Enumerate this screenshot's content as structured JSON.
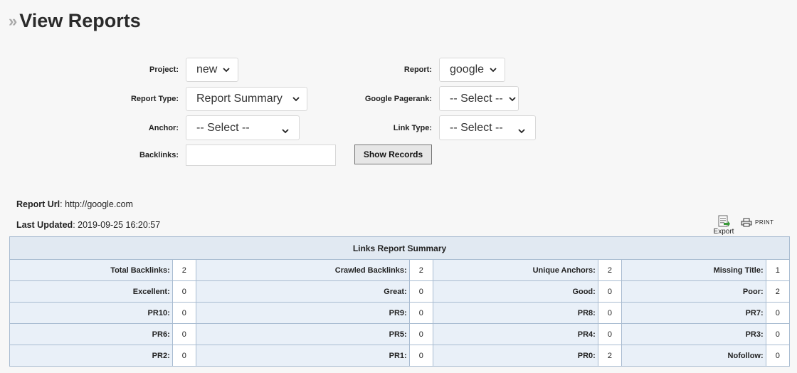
{
  "header": {
    "title": "View Reports"
  },
  "filters": {
    "project": {
      "label": "Project:",
      "value": "new"
    },
    "report": {
      "label": "Report:",
      "value": "google"
    },
    "report_type": {
      "label": "Report Type:",
      "value": "Report Summary"
    },
    "google_pagerank": {
      "label": "Google Pagerank:",
      "value": "-- Select --"
    },
    "anchor": {
      "label": "Anchor:",
      "value": "-- Select --"
    },
    "link_type": {
      "label": "Link Type:",
      "value": "-- Select --"
    },
    "backlinks": {
      "label": "Backlinks:",
      "value": ""
    },
    "show_records_label": "Show Records"
  },
  "report_info": {
    "url_label": "Report Url",
    "url_value": "http://google.com",
    "updated_label": "Last Updated",
    "updated_value": "2019-09-25 16:20:57"
  },
  "toolbar": {
    "export_label": "Export",
    "print_label": "PRINT"
  },
  "summary": {
    "title": "Links Report Summary",
    "rows": [
      [
        {
          "label": "Total Backlinks:",
          "value": "2"
        },
        {
          "label": "Crawled Backlinks:",
          "value": "2"
        },
        {
          "label": "Unique Anchors:",
          "value": "2"
        },
        {
          "label": "Missing Title:",
          "value": "1"
        }
      ],
      [
        {
          "label": "Excellent:",
          "value": "0"
        },
        {
          "label": "Great:",
          "value": "0"
        },
        {
          "label": "Good:",
          "value": "0"
        },
        {
          "label": "Poor:",
          "value": "2"
        }
      ],
      [
        {
          "label": "PR10:",
          "value": "0"
        },
        {
          "label": "PR9:",
          "value": "0"
        },
        {
          "label": "PR8:",
          "value": "0"
        },
        {
          "label": "PR7:",
          "value": "0"
        }
      ],
      [
        {
          "label": "PR6:",
          "value": "0"
        },
        {
          "label": "PR5:",
          "value": "0"
        },
        {
          "label": "PR4:",
          "value": "0"
        },
        {
          "label": "PR3:",
          "value": "0"
        }
      ],
      [
        {
          "label": "PR2:",
          "value": "0"
        },
        {
          "label": "PR1:",
          "value": "0"
        },
        {
          "label": "PR0:",
          "value": "2"
        },
        {
          "label": "Nofollow:",
          "value": "0"
        }
      ]
    ]
  }
}
